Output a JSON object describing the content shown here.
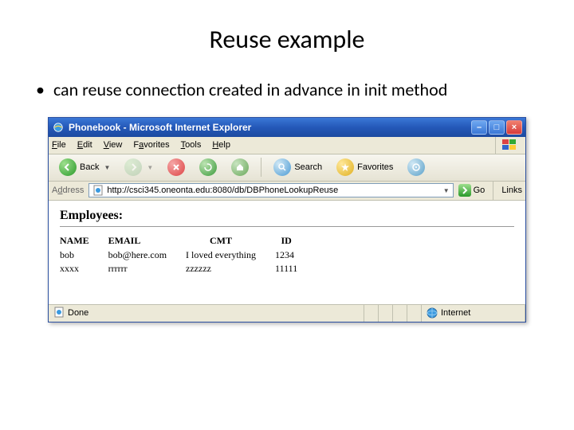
{
  "slide": {
    "title": "Reuse example",
    "bullet": "can reuse connection created in advance in init method"
  },
  "window": {
    "title": "Phonebook - Microsoft Internet Explorer"
  },
  "menu": {
    "file": "File",
    "edit": "Edit",
    "view": "View",
    "favorites": "Favorites",
    "tools": "Tools",
    "help": "Help"
  },
  "toolbar": {
    "back": "Back",
    "search": "Search",
    "favorites": "Favorites"
  },
  "address": {
    "label": "Address",
    "url": "http://csci345.oneonta.edu:8080/db/DBPhoneLookupReuse",
    "go": "Go",
    "links": "Links"
  },
  "page": {
    "heading": "Employees:",
    "headers": {
      "name": "NAME",
      "email": "EMAIL",
      "cmt": "CMT",
      "id": "ID"
    },
    "rows": [
      {
        "name": "bob",
        "email": "bob@here.com",
        "cmt": "I loved everything",
        "id": "1234"
      },
      {
        "name": "xxxx",
        "email": "rrrrrr",
        "cmt": "zzzzzz",
        "id": "11111"
      }
    ]
  },
  "status": {
    "done": "Done",
    "zone": "Internet"
  }
}
